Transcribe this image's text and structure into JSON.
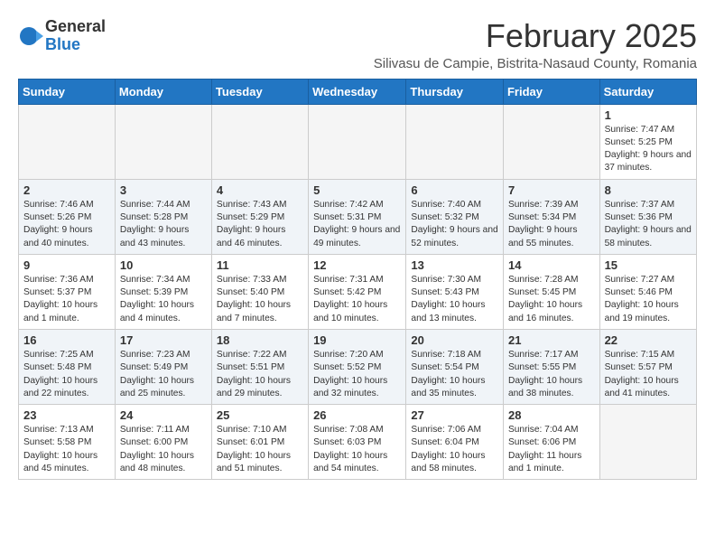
{
  "logo": {
    "general": "General",
    "blue": "Blue"
  },
  "title": {
    "month_year": "February 2025",
    "location": "Silivasu de Campie, Bistrita-Nasaud County, Romania"
  },
  "weekdays": [
    "Sunday",
    "Monday",
    "Tuesday",
    "Wednesday",
    "Thursday",
    "Friday",
    "Saturday"
  ],
  "weeks": [
    [
      {
        "day": "",
        "info": ""
      },
      {
        "day": "",
        "info": ""
      },
      {
        "day": "",
        "info": ""
      },
      {
        "day": "",
        "info": ""
      },
      {
        "day": "",
        "info": ""
      },
      {
        "day": "",
        "info": ""
      },
      {
        "day": "1",
        "info": "Sunrise: 7:47 AM\nSunset: 5:25 PM\nDaylight: 9 hours and 37 minutes."
      }
    ],
    [
      {
        "day": "2",
        "info": "Sunrise: 7:46 AM\nSunset: 5:26 PM\nDaylight: 9 hours and 40 minutes."
      },
      {
        "day": "3",
        "info": "Sunrise: 7:44 AM\nSunset: 5:28 PM\nDaylight: 9 hours and 43 minutes."
      },
      {
        "day": "4",
        "info": "Sunrise: 7:43 AM\nSunset: 5:29 PM\nDaylight: 9 hours and 46 minutes."
      },
      {
        "day": "5",
        "info": "Sunrise: 7:42 AM\nSunset: 5:31 PM\nDaylight: 9 hours and 49 minutes."
      },
      {
        "day": "6",
        "info": "Sunrise: 7:40 AM\nSunset: 5:32 PM\nDaylight: 9 hours and 52 minutes."
      },
      {
        "day": "7",
        "info": "Sunrise: 7:39 AM\nSunset: 5:34 PM\nDaylight: 9 hours and 55 minutes."
      },
      {
        "day": "8",
        "info": "Sunrise: 7:37 AM\nSunset: 5:36 PM\nDaylight: 9 hours and 58 minutes."
      }
    ],
    [
      {
        "day": "9",
        "info": "Sunrise: 7:36 AM\nSunset: 5:37 PM\nDaylight: 10 hours and 1 minute."
      },
      {
        "day": "10",
        "info": "Sunrise: 7:34 AM\nSunset: 5:39 PM\nDaylight: 10 hours and 4 minutes."
      },
      {
        "day": "11",
        "info": "Sunrise: 7:33 AM\nSunset: 5:40 PM\nDaylight: 10 hours and 7 minutes."
      },
      {
        "day": "12",
        "info": "Sunrise: 7:31 AM\nSunset: 5:42 PM\nDaylight: 10 hours and 10 minutes."
      },
      {
        "day": "13",
        "info": "Sunrise: 7:30 AM\nSunset: 5:43 PM\nDaylight: 10 hours and 13 minutes."
      },
      {
        "day": "14",
        "info": "Sunrise: 7:28 AM\nSunset: 5:45 PM\nDaylight: 10 hours and 16 minutes."
      },
      {
        "day": "15",
        "info": "Sunrise: 7:27 AM\nSunset: 5:46 PM\nDaylight: 10 hours and 19 minutes."
      }
    ],
    [
      {
        "day": "16",
        "info": "Sunrise: 7:25 AM\nSunset: 5:48 PM\nDaylight: 10 hours and 22 minutes."
      },
      {
        "day": "17",
        "info": "Sunrise: 7:23 AM\nSunset: 5:49 PM\nDaylight: 10 hours and 25 minutes."
      },
      {
        "day": "18",
        "info": "Sunrise: 7:22 AM\nSunset: 5:51 PM\nDaylight: 10 hours and 29 minutes."
      },
      {
        "day": "19",
        "info": "Sunrise: 7:20 AM\nSunset: 5:52 PM\nDaylight: 10 hours and 32 minutes."
      },
      {
        "day": "20",
        "info": "Sunrise: 7:18 AM\nSunset: 5:54 PM\nDaylight: 10 hours and 35 minutes."
      },
      {
        "day": "21",
        "info": "Sunrise: 7:17 AM\nSunset: 5:55 PM\nDaylight: 10 hours and 38 minutes."
      },
      {
        "day": "22",
        "info": "Sunrise: 7:15 AM\nSunset: 5:57 PM\nDaylight: 10 hours and 41 minutes."
      }
    ],
    [
      {
        "day": "23",
        "info": "Sunrise: 7:13 AM\nSunset: 5:58 PM\nDaylight: 10 hours and 45 minutes."
      },
      {
        "day": "24",
        "info": "Sunrise: 7:11 AM\nSunset: 6:00 PM\nDaylight: 10 hours and 48 minutes."
      },
      {
        "day": "25",
        "info": "Sunrise: 7:10 AM\nSunset: 6:01 PM\nDaylight: 10 hours and 51 minutes."
      },
      {
        "day": "26",
        "info": "Sunrise: 7:08 AM\nSunset: 6:03 PM\nDaylight: 10 hours and 54 minutes."
      },
      {
        "day": "27",
        "info": "Sunrise: 7:06 AM\nSunset: 6:04 PM\nDaylight: 10 hours and 58 minutes."
      },
      {
        "day": "28",
        "info": "Sunrise: 7:04 AM\nSunset: 6:06 PM\nDaylight: 11 hours and 1 minute."
      },
      {
        "day": "",
        "info": ""
      }
    ]
  ]
}
